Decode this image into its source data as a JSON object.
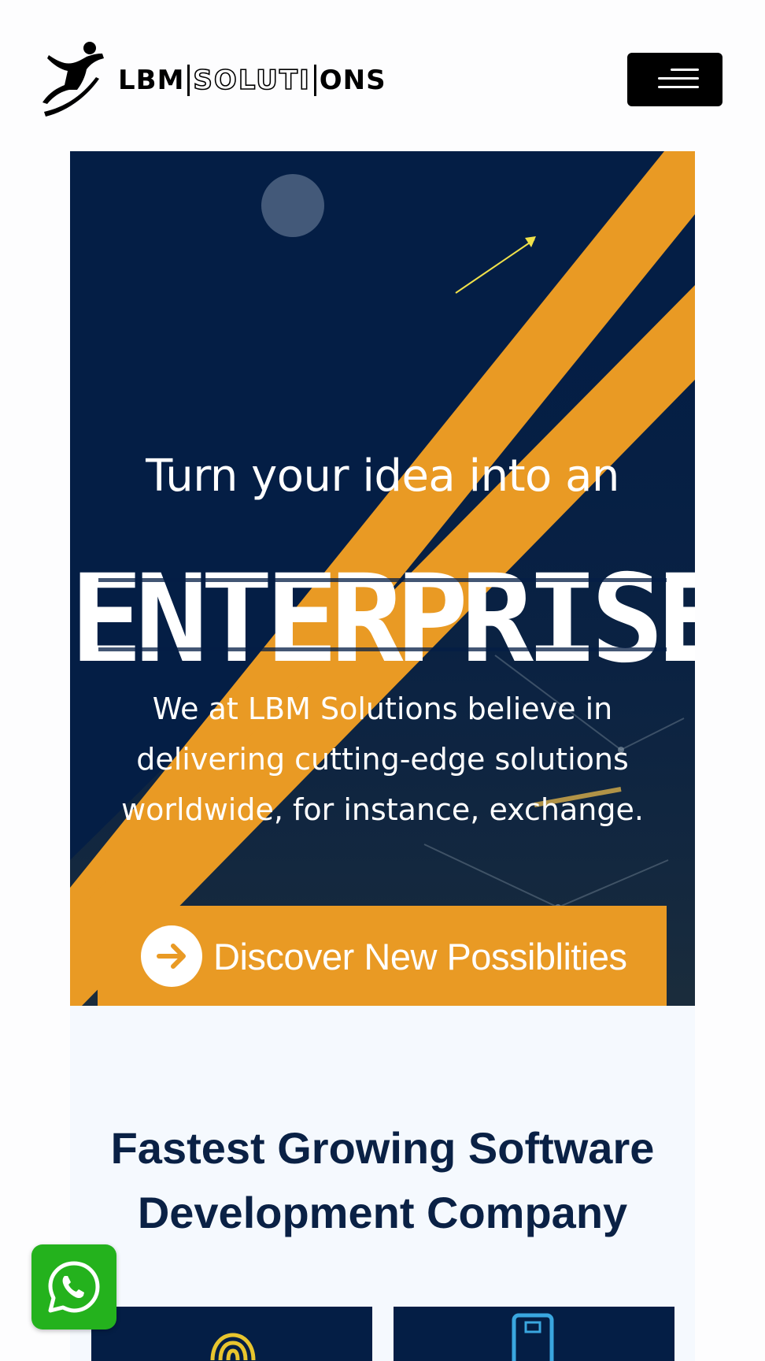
{
  "header": {
    "logo_parts": [
      "LBM",
      "SOLUTI",
      "ONS"
    ],
    "menu_label": "Menu"
  },
  "hero": {
    "title": "Turn your idea into an",
    "big_word": "ENTERPRISE",
    "description_lines": [
      "We at LBM Solutions believe in",
      "delivering cutting-edge solutions",
      "worldwide, for instance, exchange."
    ],
    "cta_label": "Discover New Possiblities"
  },
  "section": {
    "title_lines": [
      "Fastest Growing Software",
      "Development Company"
    ]
  },
  "colors": {
    "navy": "#041e45",
    "accent_orange": "#e99a24",
    "section_bg": "#f5f9fe",
    "heading_navy": "#0a2145",
    "whatsapp_green": "#24b21d"
  },
  "icons": {
    "menu": "hamburger-icon",
    "cta": "arrow-right-icon",
    "whatsapp": "whatsapp-icon",
    "card1": "fingerprint-icon",
    "card2": "mobile-device-icon"
  }
}
